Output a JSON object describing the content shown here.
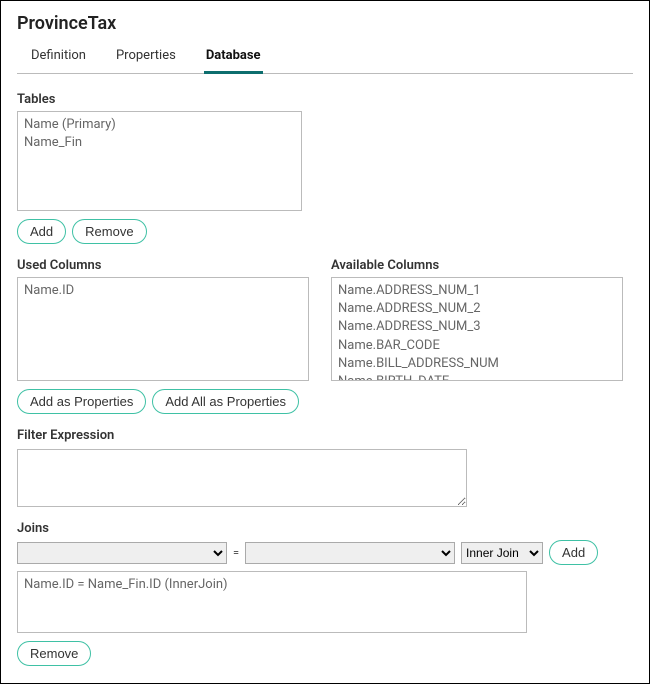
{
  "title": "ProvinceTax",
  "tabs": {
    "definition": "Definition",
    "properties": "Properties",
    "database": "Database"
  },
  "tables": {
    "label": "Tables",
    "items": [
      "Name (Primary)",
      "Name_Fin"
    ],
    "add_label": "Add",
    "remove_label": "Remove"
  },
  "used_columns": {
    "label": "Used Columns",
    "items": [
      "Name.ID"
    ],
    "add_as_props_label": "Add as Properties",
    "add_all_as_props_label": "Add All as Properties"
  },
  "available_columns": {
    "label": "Available Columns",
    "items": [
      "Name.ADDRESS_NUM_1",
      "Name.ADDRESS_NUM_2",
      "Name.ADDRESS_NUM_3",
      "Name.BAR_CODE",
      "Name.BILL_ADDRESS_NUM",
      "Name.BIRTH_DATE"
    ]
  },
  "filter": {
    "label": "Filter Expression",
    "value": ""
  },
  "joins": {
    "label": "Joins",
    "eq": "=",
    "type_selected": "Inner Join",
    "add_label": "Add",
    "items": [
      "Name.ID = Name_Fin.ID (InnerJoin)"
    ],
    "remove_label": "Remove"
  }
}
